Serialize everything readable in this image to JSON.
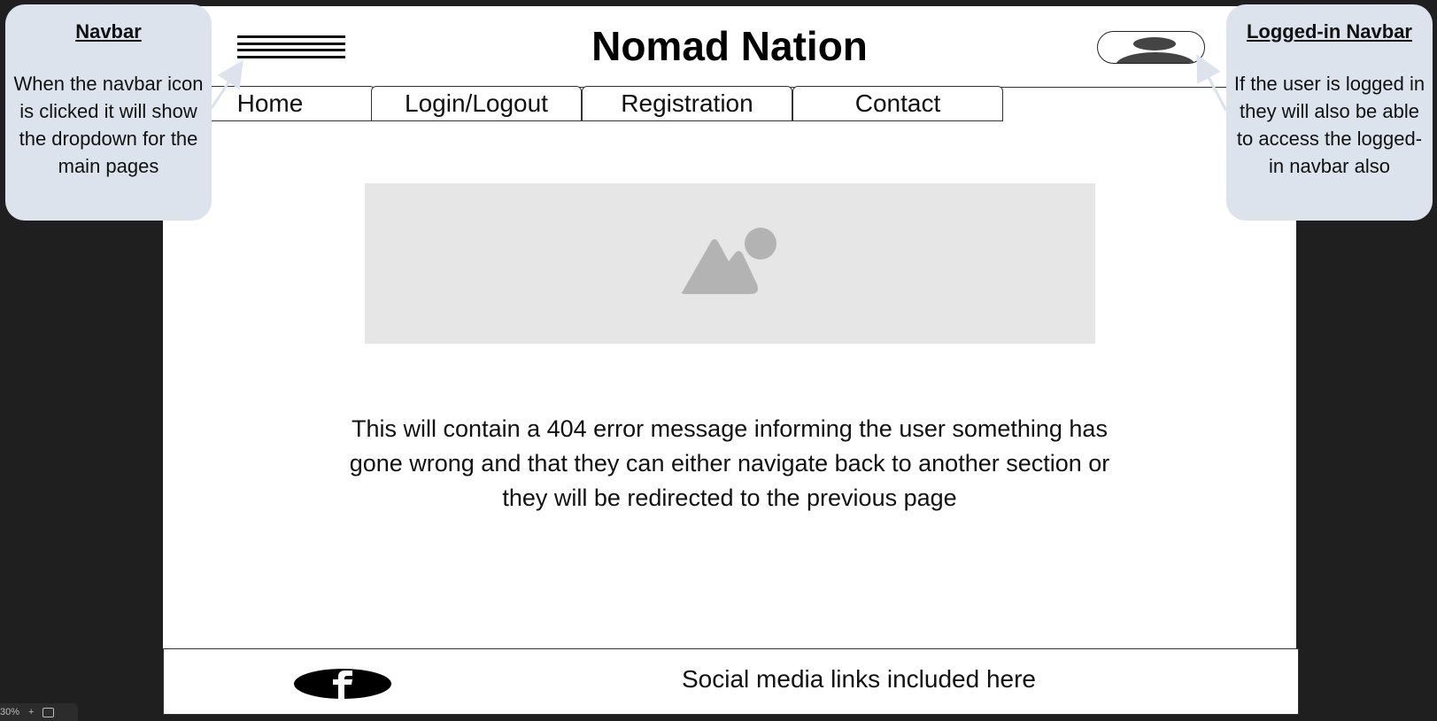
{
  "site": {
    "title": "Nomad Nation"
  },
  "navbar": {
    "tabs": [
      {
        "label": "Home"
      },
      {
        "label": "Login/Logout"
      },
      {
        "label": "Registration"
      },
      {
        "label": "Contact"
      }
    ]
  },
  "main": {
    "message": "This will contain a 404 error message informing the user something has gone wrong and that they can either navigate back to another section or they will be redirected to the previous page"
  },
  "footer": {
    "text": "Social media links included here"
  },
  "annotations": {
    "navbar": {
      "title": "Navbar",
      "body": "When the navbar icon is clicked it will show the dropdown for the main pages"
    },
    "logged_in": {
      "title": "Logged-in Navbar",
      "body": "If the user is logged in they will also be able to access the logged-in navbar also"
    }
  },
  "zoom": {
    "level": "30%",
    "plus": "+"
  },
  "icons": {
    "menu": "hamburger-menu-icon",
    "profile": "user-profile-icon",
    "image": "image-placeholder-icon",
    "social": "facebook-icon"
  },
  "colors": {
    "background": "#1f1f1f",
    "canvas": "#ffffff",
    "note": "#dde3ec",
    "placeholder": "#e6e6e6"
  }
}
